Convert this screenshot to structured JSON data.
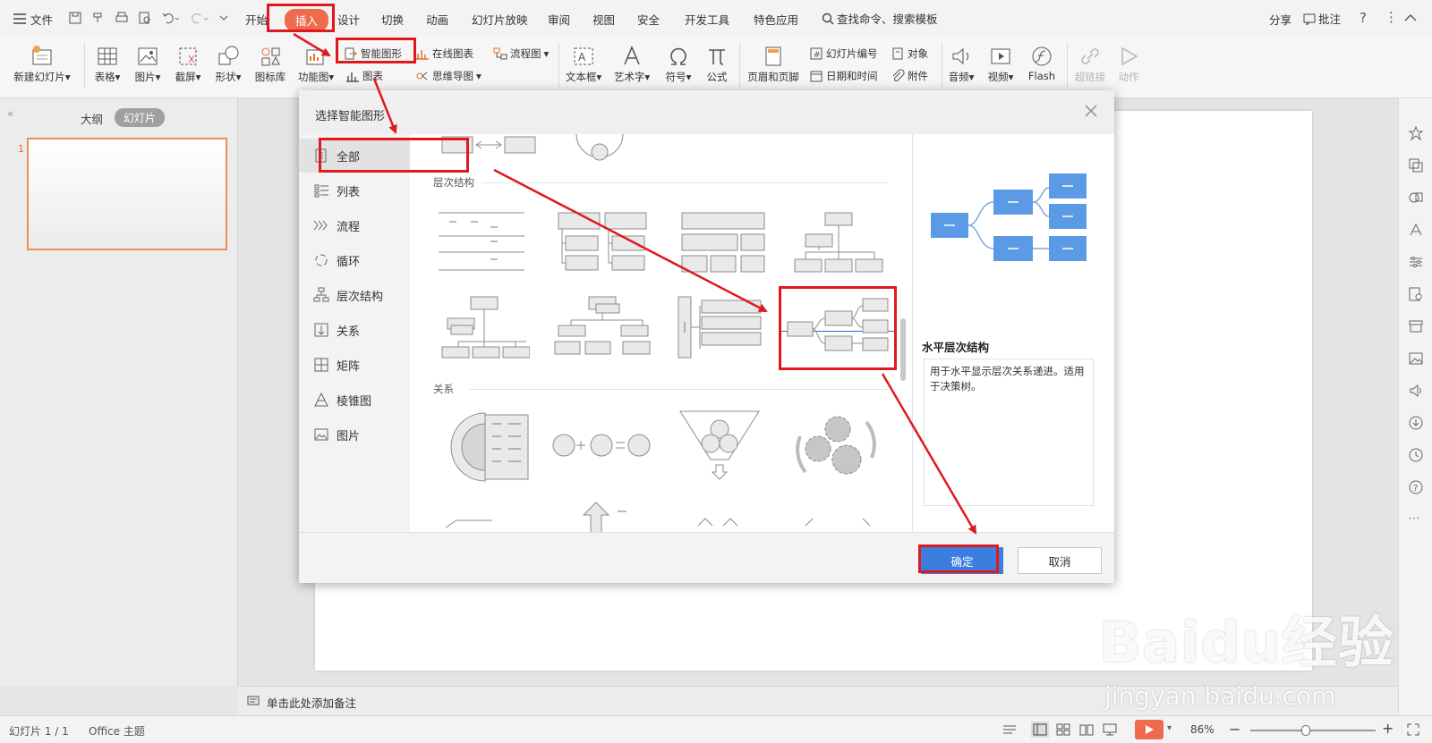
{
  "menubar": {
    "file": "文件",
    "tabs": [
      "开始",
      "插入",
      "设计",
      "切换",
      "动画",
      "幻灯片放映",
      "审阅",
      "视图",
      "安全",
      "开发工具",
      "特色应用"
    ],
    "active_tab": "插入",
    "search": "查找命令、搜索模板",
    "share": "分享",
    "comment": "批注"
  },
  "ribbon": {
    "new_slide": "新建幻灯片",
    "table": "表格",
    "picture": "图片",
    "screenshot": "截屏",
    "shape": "形状",
    "icon_lib": "图标库",
    "function_chart": "功能图",
    "smart_art": "智能图形",
    "chart": "图表",
    "online_chart": "在线图表",
    "flowchart": "流程图",
    "mindmap": "思维导图",
    "textbox": "文本框",
    "wordart": "艺术字",
    "symbol": "符号",
    "formula": "公式",
    "header_footer": "页眉和页脚",
    "slide_number": "幻灯片编号",
    "object": "对象",
    "datetime": "日期和时间",
    "attachment": "附件",
    "audio": "音频",
    "video": "视频",
    "flash": "Flash",
    "hyperlink": "超链接",
    "action": "动作"
  },
  "leftpanel": {
    "tab_outline": "大纲",
    "tab_slides": "幻灯片",
    "slide_number": "1"
  },
  "dialog": {
    "title": "选择智能图形",
    "categories": [
      "全部",
      "列表",
      "流程",
      "循环",
      "层次结构",
      "关系",
      "矩阵",
      "棱锥图",
      "图片"
    ],
    "selected_category": "全部",
    "section_hierarchy": "层次结构",
    "section_relation": "关系",
    "preview_title": "水平层次结构",
    "preview_desc": "用于水平显示层次关系递进。适用于决策树。",
    "ok": "确定",
    "cancel": "取消"
  },
  "notes": {
    "placeholder": "单击此处添加备注"
  },
  "statusbar": {
    "slide_info": "幻灯片 1 / 1",
    "theme": "Office 主题",
    "zoom": "86%"
  },
  "watermark": {
    "logo": "Baidu经验",
    "url": "jingyan.baidu.com"
  },
  "colors": {
    "accent_orange": "#ee6c4d",
    "highlight_red": "#e0191f",
    "ok_blue": "#3b7ee0",
    "preview_blue": "#5b9be6",
    "slide_border": "#f08c5a"
  }
}
